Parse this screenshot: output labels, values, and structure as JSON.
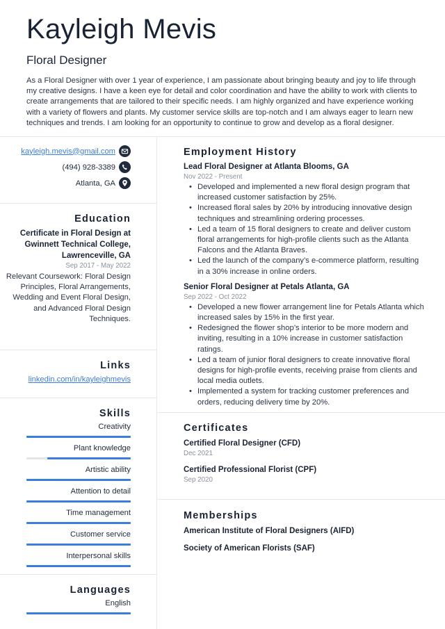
{
  "header": {
    "name": "Kayleigh Mevis",
    "title": "Floral Designer",
    "summary": "As a Floral Designer with over 1 year of experience, I am passionate about bringing beauty and joy to life through my creative designs. I have a keen eye for detail and color coordination and have the ability to work with clients to create arrangements that are tailored to their specific needs. I am highly organized and have experience working with a variety of flowers and plants. My customer service skills are top-notch and I am always eager to learn new techniques and trends. I am looking for an opportunity to continue to grow and develop as a floral designer."
  },
  "contact": {
    "email": "kayleigh.mevis@gmail.com",
    "email_icon": "envelope-icon",
    "phone": "(494) 928-3389",
    "phone_icon": "phone-icon",
    "location": "Atlanta, GA",
    "location_icon": "map-pin-icon"
  },
  "education": {
    "heading": "Education",
    "title": "Certificate in Floral Design at Gwinnett Technical College, Lawrenceville, GA",
    "dates": "Sep 2017 - May 2022",
    "description": "Relevant Coursework: Floral Design Principles, Floral Arrangements, Wedding and Event Floral Design, and Advanced Floral Design Techniques."
  },
  "links": {
    "heading": "Links",
    "items": [
      "linkedin.com/in/kayleighmevis"
    ]
  },
  "skills": {
    "heading": "Skills",
    "items": [
      {
        "label": "Creativity",
        "level": 1.0
      },
      {
        "label": "Plant knowledge",
        "level": 0.8
      },
      {
        "label": "Artistic ability",
        "level": 1.0
      },
      {
        "label": "Attention to detail",
        "level": 1.0
      },
      {
        "label": "Time management",
        "level": 1.0
      },
      {
        "label": "Customer service",
        "level": 1.0
      },
      {
        "label": "Interpersonal skills",
        "level": 1.0
      }
    ]
  },
  "languages": {
    "heading": "Languages",
    "items": [
      {
        "label": "English",
        "level": 1.0
      }
    ]
  },
  "employment": {
    "heading": "Employment History",
    "jobs": [
      {
        "title": "Lead Floral Designer at Atlanta Blooms, GA",
        "dates": "Nov 2022 - Present",
        "bullets": [
          "Developed and implemented a new floral design program that increased customer satisfaction by 25%.",
          "Increased floral sales by 20% by introducing innovative design techniques and streamlining ordering processes.",
          "Led a team of 15 floral designers to create and deliver custom floral arrangements for high-profile clients such as the Atlanta Falcons and the Atlanta Braves.",
          "Led the launch of the company’s e-commerce platform, resulting in a 30% increase in online orders."
        ]
      },
      {
        "title": "Senior Floral Designer at Petals Atlanta, GA",
        "dates": "Sep 2022 - Oct 2022",
        "bullets": [
          "Developed a new flower arrangement line for Petals Atlanta which increased sales by 15% in the first year.",
          "Redesigned the flower shop’s interior to be more modern and inviting, resulting in a 10% increase in customer satisfaction ratings.",
          "Led a team of junior floral designers to create innovative floral designs for high-profile events, receiving praise from clients and local media outlets.",
          "Implemented a system for tracking customer preferences and orders, reducing delivery time by 20%."
        ]
      }
    ]
  },
  "certificates": {
    "heading": "Certificates",
    "items": [
      {
        "title": "Certified Floral Designer (CFD)",
        "date": "Dec 2021"
      },
      {
        "title": "Certified Professional Florist (CPF)",
        "date": "Sep 2020"
      }
    ]
  },
  "memberships": {
    "heading": "Memberships",
    "items": [
      "American Institute of Floral Designers (AIFD)",
      "Society of American Florists (SAF)"
    ]
  },
  "colors": {
    "accent": "#3b7ddd",
    "text": "#1a2334",
    "muted": "#8b919b",
    "divider": "#e6e8eb"
  }
}
